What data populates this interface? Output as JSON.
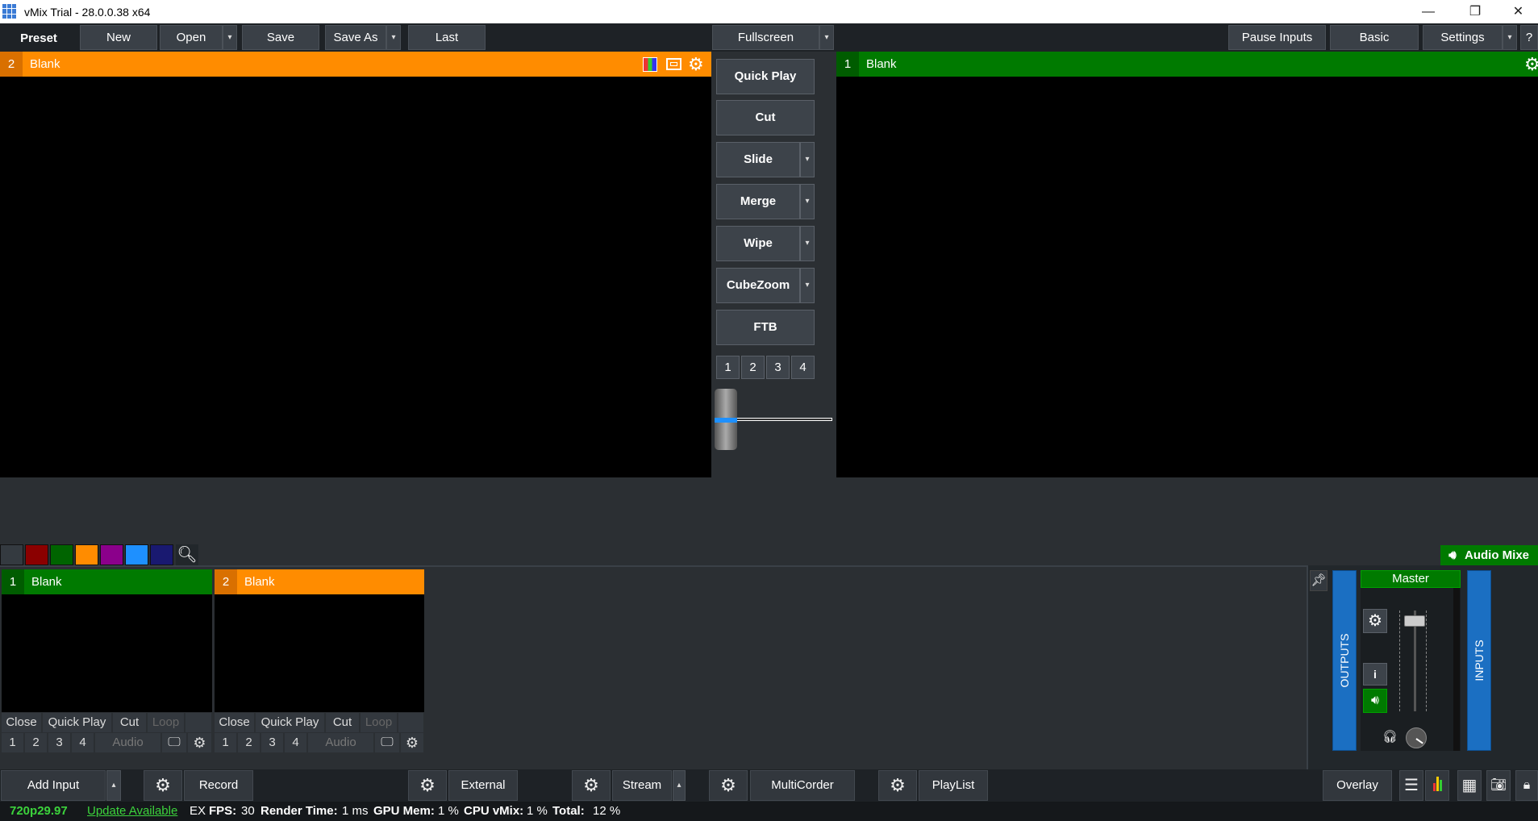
{
  "window": {
    "title": "vMix Trial - 28.0.0.38 x64",
    "minimize": "—",
    "restore": "❐",
    "close": "✕"
  },
  "toolbar": {
    "preset": "Preset",
    "new": "New",
    "open": "Open",
    "save": "Save",
    "save_as": "Save As",
    "last": "Last",
    "fullscreen": "Fullscreen",
    "pause_inputs": "Pause Inputs",
    "basic": "Basic",
    "settings": "Settings",
    "help": "?",
    "dropdown_glyph": "▾"
  },
  "preview": {
    "number": "2",
    "title": "Blank",
    "color": "#ff8c00"
  },
  "output": {
    "number": "1",
    "title": "Blank",
    "color": "#007a00"
  },
  "transitions": {
    "quick_play": "Quick Play",
    "cut": "Cut",
    "slide": "Slide",
    "merge": "Merge",
    "wipe": "Wipe",
    "cubezoom": "CubeZoom",
    "ftb": "FTB",
    "quick_numbers": [
      "1",
      "2",
      "3",
      "4"
    ]
  },
  "color_filters": [
    "#343a40",
    "#8b0000",
    "#006400",
    "#ff8c00",
    "#8b008b",
    "#1e90ff",
    "#191970"
  ],
  "inputs": [
    {
      "number": "1",
      "title": "Blank",
      "color": "#007a00",
      "close": "Close",
      "quick_play": "Quick Play",
      "cut": "Cut",
      "loop": "Loop",
      "nums": [
        "1",
        "2",
        "3",
        "4"
      ],
      "audio": "Audio"
    },
    {
      "number": "2",
      "title": "Blank",
      "color": "#ff8c00",
      "close": "Close",
      "quick_play": "Quick Play",
      "cut": "Cut",
      "loop": "Loop",
      "nums": [
        "1",
        "2",
        "3",
        "4"
      ],
      "audio": "Audio"
    }
  ],
  "audio_mixer": {
    "label": "Audio Mixe",
    "master": "Master",
    "outputs": "OUTPUTS",
    "inputs": "INPUTS",
    "info": "i",
    "fader_level": 0.95
  },
  "bottom": {
    "add_input": "Add Input",
    "record": "Record",
    "external": "External",
    "stream": "Stream",
    "multicorder": "MultiCorder",
    "playlist": "PlayList",
    "overlay": "Overlay"
  },
  "status": {
    "format": "720p29.97",
    "update": "Update Available",
    "ex": "EX",
    "fps_label": "FPS:",
    "fps": "30",
    "render_label": "Render Time:",
    "render": "1 ms",
    "gpu_label": "GPU Mem:",
    "gpu": "1 %",
    "cpu_label": "CPU vMix:",
    "cpu": "1 %",
    "total_label": "Total:",
    "total": "12 %"
  }
}
